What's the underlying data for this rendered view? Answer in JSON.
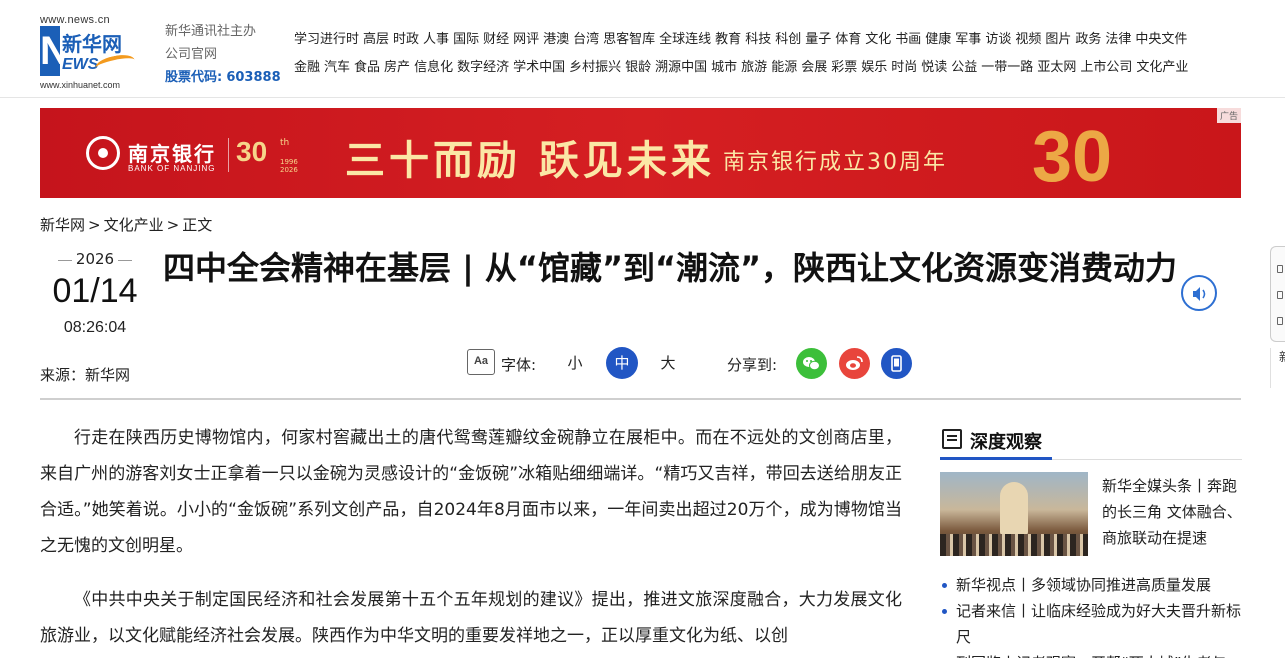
{
  "header": {
    "logo": {
      "url_top": "www.news.cn",
      "mark": "N",
      "cn_name": "新华网",
      "ews": "EWS",
      "url_bottom": "www.xinhuanet.com"
    },
    "org_line1": "新华通讯社主办",
    "org_line2": "公司官网",
    "stock_label": "股票代码:",
    "stock_code": "603888",
    "nav_row1": [
      "学习进行时",
      "高层",
      "时政",
      "人事",
      "国际",
      "财经",
      "网评",
      "港澳",
      "台湾",
      "思客智库",
      "全球连线",
      "教育",
      "科技",
      "科创",
      "量子",
      "体育",
      "文化",
      "书画",
      "健康",
      "军事",
      "访谈",
      "视频",
      "图片",
      "政务",
      "法律",
      "中央文件"
    ],
    "nav_row2": [
      "金融",
      "汽车",
      "食品",
      "房产",
      "信息化",
      "数字经济",
      "学术中国",
      "乡村振兴",
      "银龄",
      "溯源中国",
      "城市",
      "旅游",
      "能源",
      "会展",
      "彩票",
      "娱乐",
      "时尚",
      "悦读",
      "公益",
      "一带一路",
      "亚太网",
      "上市公司",
      "文化产业"
    ]
  },
  "banner": {
    "ad_tag": "广告",
    "bank_name": "南京银行",
    "bank_en": "BANK OF NANJING",
    "anniversary": "30",
    "anniversary_sup": "th",
    "anniversary_years": "1996\n2026",
    "slogan": "三十而励 跃见未来",
    "sub_slogan": "南京银行成立30周年",
    "big_number": "30"
  },
  "breadcrumb": {
    "items": [
      "新华网",
      "文化产业",
      "正文"
    ],
    "sep": ">"
  },
  "meta": {
    "year": "2026",
    "month_day": "01/14",
    "time": "08:26:04",
    "source": "来源：新华网"
  },
  "title": "四中全会精神在基层 | 从“馆藏”到“潮流”，陕西让文化资源变消费动力",
  "toolbar": {
    "font_icon": "Aa",
    "font_label": "字体:",
    "size_small": "小",
    "size_mid": "中",
    "size_large": "大",
    "share_label": "分享到:"
  },
  "article": {
    "paragraphs": [
      "行走在陕西历史博物馆内，何家村窖藏出土的唐代鸳鸯莲瓣纹金碗静立在展柜中。而在不远处的文创商店里，来自广州的游客刘女士正拿着一只以金碗为灵感设计的“金饭碗”冰箱贴细细端详。“精巧又吉祥，带回去送给朋友正合适。”她笑着说。小小的“金饭碗”系列文创产品，自2024年8月面市以来，一年间卖出超过20万个，成为博物馆当之无愧的文创明星。",
      "《中共中央关于制定国民经济和社会发展第十五个五年规划的建议》提出，推进文旅深度融合，大力发展文化旅游业，以文化赋能经济社会发展。陕西作为中华文明的重要发祥地之一，正以厚重文化为纸、以创"
    ]
  },
  "sidebar": {
    "heading": "深度观察",
    "feature_caption": "新华全媒头条丨奔跑的长三角 文体融合、商旅联动在提速",
    "items": [
      "新华视点丨多领域协同推进高质量发展",
      "记者来信丨让临床经验成为好大夫晋升新标尺",
      "列国鉴丨记者观察：开帮“死人城”生者与"
    ]
  },
  "edge": {
    "char": "新"
  },
  "colors": {
    "brand_blue": "#1b5fb7",
    "accent_blue": "#2156c4",
    "banner_red": "#c5141c",
    "wechat_green": "#3cbf3a",
    "weibo_red": "#e8453c"
  }
}
